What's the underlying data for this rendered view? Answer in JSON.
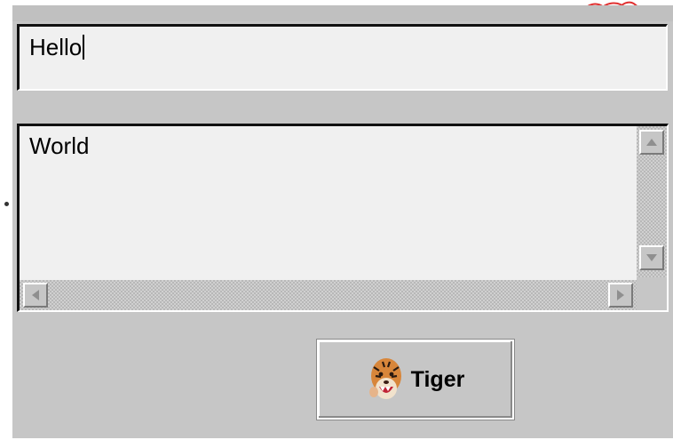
{
  "text_field": {
    "value": "Hello"
  },
  "text_area": {
    "value": "World"
  },
  "scrollbars": {
    "vertical": {
      "up_icon": "arrow-up-icon",
      "down_icon": "arrow-down-icon"
    },
    "horizontal": {
      "left_icon": "arrow-left-icon",
      "right_icon": "arrow-right-icon"
    }
  },
  "tiger_button": {
    "label": "Tiger",
    "icon": "tiger-icon"
  },
  "colors": {
    "window_bg": "#c6c6c6",
    "field_bg": "#f0f0f0",
    "accent_red": "#e03030"
  }
}
